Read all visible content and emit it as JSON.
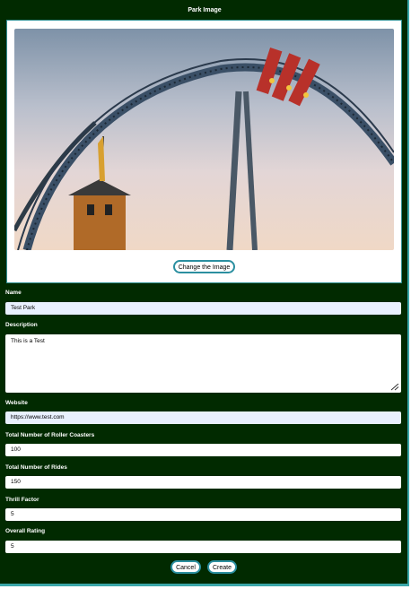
{
  "form": {
    "image_section_title": "Park Image",
    "change_image_label": "Change the Image",
    "fields": {
      "name": {
        "label": "Name",
        "value": "Test Park"
      },
      "description": {
        "label": "Description",
        "value": "This is a Test"
      },
      "website": {
        "label": "Website",
        "value": "https://www.test.com"
      },
      "coasters": {
        "label": "Total Number of Roller Coasters",
        "value": "100"
      },
      "rides": {
        "label": "Total Number of Rides",
        "value": "150"
      },
      "thrill": {
        "label": "Thrill Factor",
        "value": "5"
      },
      "rating": {
        "label": "Overall Rating",
        "value": "5"
      }
    },
    "cancel_label": "Cancel",
    "create_label": "Create"
  },
  "colors": {
    "background": "#012a00",
    "accent": "#3aa6a8",
    "autofill": "#e8f0fe"
  }
}
